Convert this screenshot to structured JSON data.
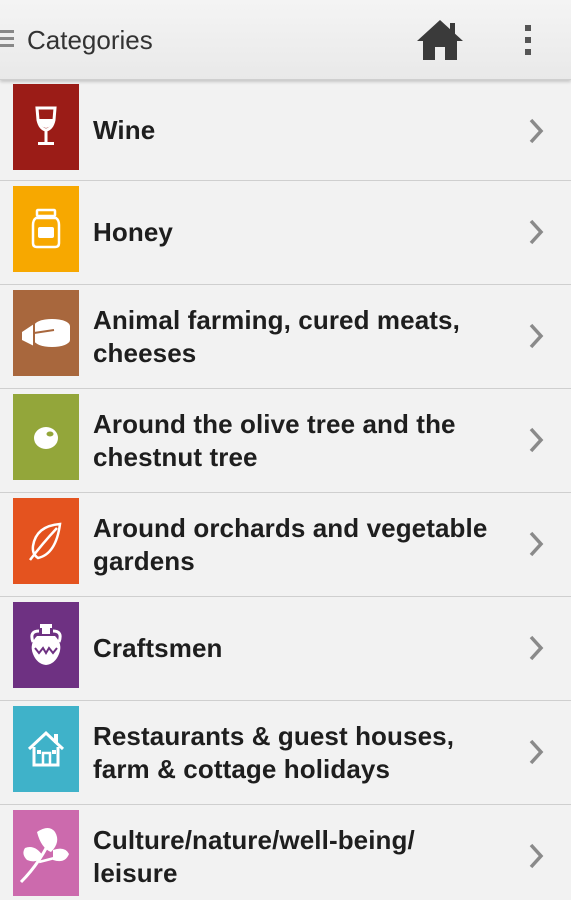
{
  "action_bar": {
    "title": "Categories",
    "home_icon": "home-icon",
    "overflow_icon": "overflow-menu-icon"
  },
  "categories": [
    {
      "label": "Wine",
      "icon": "wine-glass-icon",
      "color": "#9b1c17"
    },
    {
      "label": "Honey",
      "icon": "honey-jar-icon",
      "color": "#f7a800"
    },
    {
      "label": "Animal farming, cured meats, cheeses",
      "icon": "cheese-icon",
      "color": "#a8673d"
    },
    {
      "label": "Around the olive tree and the chestnut tree",
      "icon": "olive-icon",
      "color": "#93a63a"
    },
    {
      "label": "Around orchards and vegetable gardens",
      "icon": "leaf-icon",
      "color": "#e4531f"
    },
    {
      "label": "Craftsmen",
      "icon": "amphora-icon",
      "color": "#6e3182"
    },
    {
      "label": "Restaurants & guest houses, farm & cottage holidays",
      "icon": "house-icon",
      "color": "#3fb2c9"
    },
    {
      "label": "Culture/nature/well-being/ leisure",
      "icon": "plant-icon",
      "color": "#cc6aad"
    }
  ]
}
